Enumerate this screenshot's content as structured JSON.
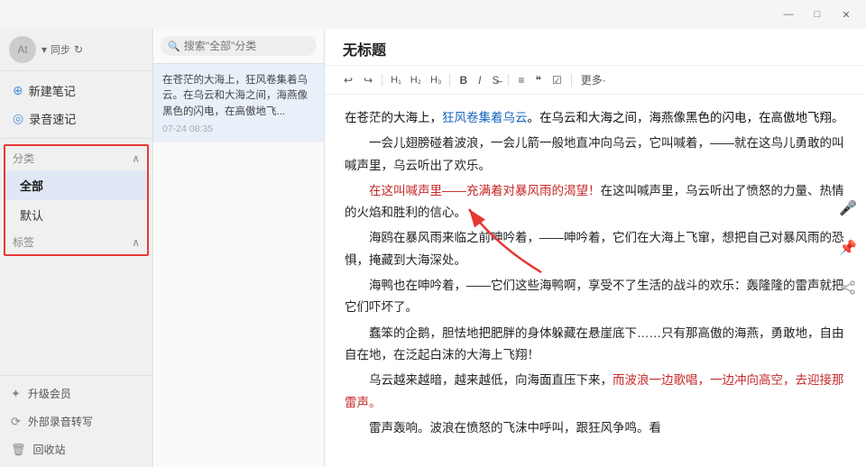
{
  "titlebar": {
    "minimize_label": "—",
    "maximize_label": "□",
    "close_label": "✕"
  },
  "sidebar": {
    "user": {
      "avatar_text": "At",
      "sync_label": "同步",
      "sync_icon": "↻"
    },
    "actions": [
      {
        "id": "new-note",
        "icon": "＋",
        "label": "新建笔记"
      },
      {
        "id": "voice-note",
        "icon": "◎",
        "label": "录音速记"
      }
    ],
    "categories": {
      "header": "分类",
      "items": [
        {
          "id": "all",
          "label": "全部",
          "active": true
        },
        {
          "id": "default",
          "label": "默认"
        }
      ]
    },
    "tags": {
      "header": "标签",
      "chevron": "∧"
    },
    "bottom_items": [
      {
        "id": "upgrade",
        "icon": "★",
        "label": "升级会员"
      },
      {
        "id": "external",
        "icon": "⟳",
        "label": "外部录音转写"
      },
      {
        "id": "trash",
        "icon": "🗑",
        "label": "回收站"
      }
    ]
  },
  "note_list": {
    "search_placeholder": "搜索\"全部\"分类",
    "notes": [
      {
        "id": 1,
        "text": "在苍茫的大海上，狂风卷集着乌云。在乌云和大海之间，海燕像黑色的闪电，在高傲地飞...",
        "date": "07-24 08:35"
      }
    ]
  },
  "editor": {
    "title": "无标题",
    "toolbar": {
      "undo": "↩",
      "redo": "↪",
      "h1": "H₁",
      "h2": "H₂",
      "h3": "H₃",
      "bold": "B",
      "italic": "I",
      "strikethrough": "S̶",
      "list": "≡",
      "quote": "❝",
      "checkbox": "☑",
      "more": "更多·"
    },
    "content": [
      {
        "type": "first",
        "text": "在苍茫的大海上，狂风卷集着乌云。在乌云和大海之间，海燕像黑色的闪电，在高傲地飞翔。"
      },
      {
        "type": "normal",
        "text": "一会儿翅膀碰着波浪，一会儿箭一般地直冲向乌云，它叫喊着，——就在这鸟儿勇敢的叫喊声里，乌云听出了欢乐。"
      },
      {
        "type": "normal",
        "text": "在这叫喊声里——充满着对暴风雨的渴望！在这叫喊声里，乌云听出了愤怒的力量、热情的火焰和胜利的信心。"
      },
      {
        "type": "normal",
        "text": "海鸥在暴风雨来临之前呻吟着，——呻吟着，它们在大海上飞窜，想把自己对暴风雨的恐惧，掩藏到大海深处。"
      },
      {
        "type": "normal",
        "text": "海鸭也在呻吟着，——它们这些海鸭啊，享受不了生活的战斗的欢乐：轰隆隆的雷声就把它们吓坏了。"
      },
      {
        "type": "normal",
        "text": "蠢笨的企鹅，胆怯地把肥胖的身体躲藏在悬崖底下……只有那高傲的海燕，勇敢地，自由自在地，在泛起白沫的大海上飞翔！"
      },
      {
        "type": "normal",
        "text": "乌云越来越暗，越来越低，向海面直压下来，而波浪一边歌唱，一边冲向高空，去迎接那雷声。"
      },
      {
        "type": "normal",
        "text": "雷声轰响。波浪在愤怒的飞沫中呼叫，跟狂风争鸣。看"
      }
    ]
  },
  "right_icons": [
    {
      "id": "microphone",
      "icon": "🎤"
    },
    {
      "id": "pin",
      "icon": "📍"
    },
    {
      "id": "share",
      "icon": "↗"
    }
  ]
}
